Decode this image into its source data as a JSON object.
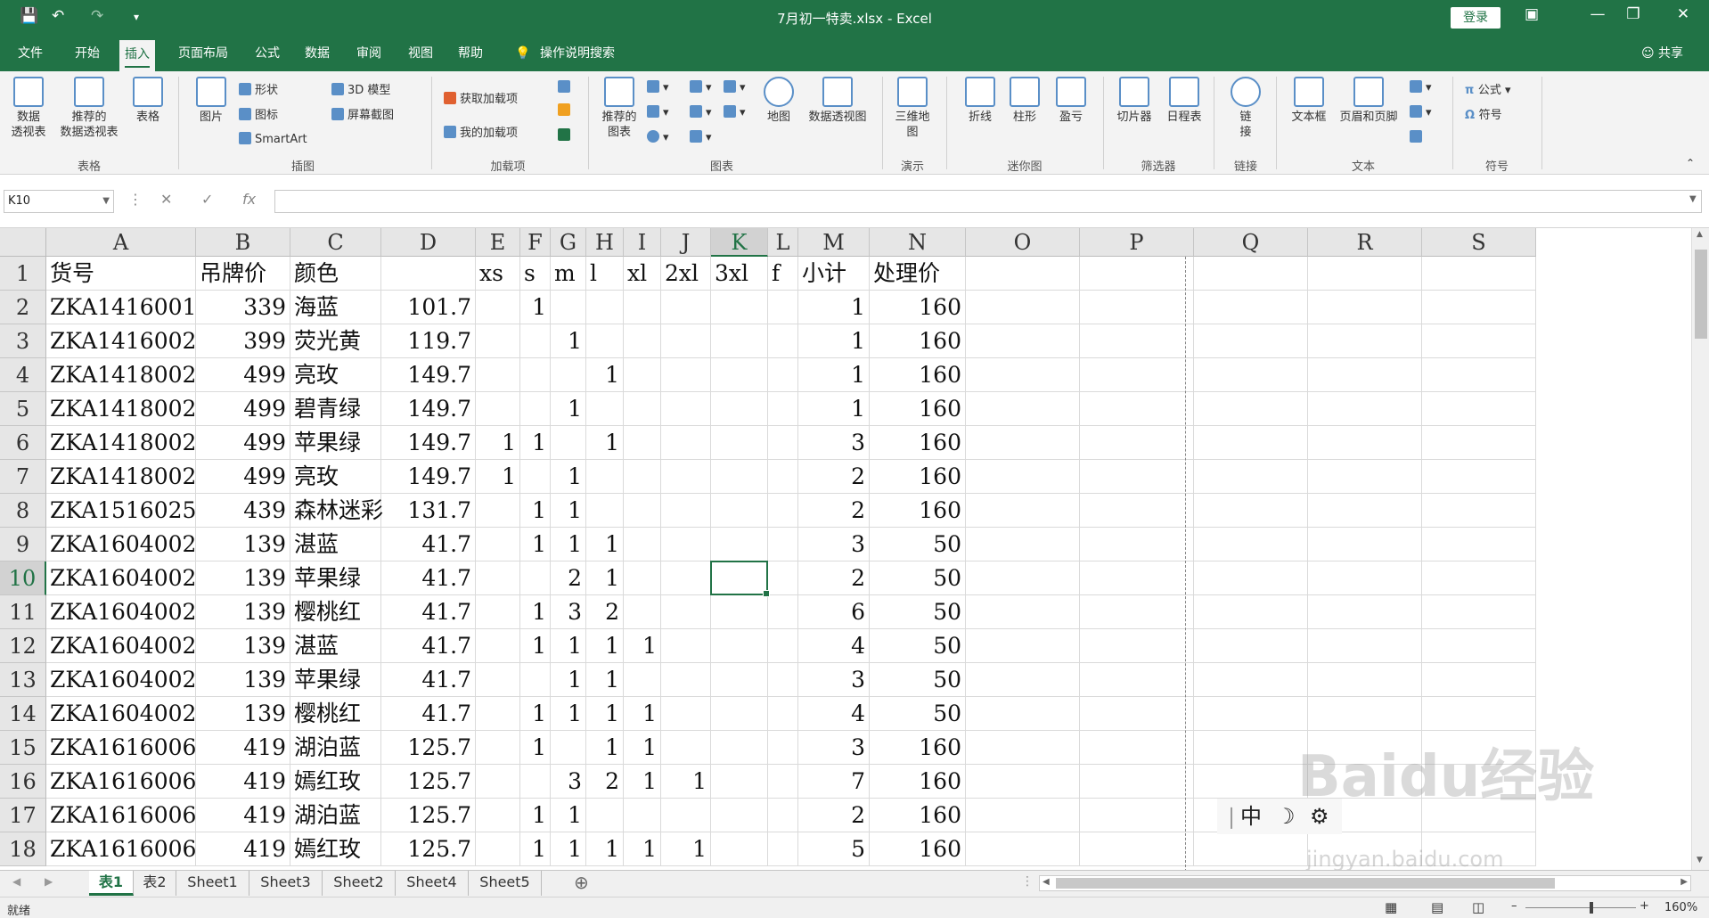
{
  "window": {
    "title": "7月初一特卖.xlsx  -  Excel",
    "login_label": "登录",
    "share_label": "共享",
    "tell_me": "操作说明搜索"
  },
  "tabs": [
    "文件",
    "开始",
    "插入",
    "页面布局",
    "公式",
    "数据",
    "审阅",
    "视图",
    "帮助"
  ],
  "active_tab": "插入",
  "ribbon": {
    "groups": [
      "表格",
      "插图",
      "加载项",
      "图表",
      "演示",
      "迷你图",
      "筛选器",
      "链接",
      "文本",
      "符号"
    ],
    "table_btns": [
      "数据\n透视表",
      "推荐的\n数据透视表",
      "表格"
    ],
    "illus_big": "图片",
    "illus_small": [
      "形状",
      "图标",
      "SmartArt",
      "3D 模型",
      "屏幕截图"
    ],
    "addins": [
      "获取加载项",
      "我的加载项"
    ],
    "charts": [
      "推荐的\n图表",
      "地图",
      "数据透视图"
    ],
    "tour": "三维地\n图",
    "spark": [
      "折线",
      "柱形",
      "盈亏"
    ],
    "filters": [
      "切片器",
      "日程表"
    ],
    "link": "链\n接",
    "text": [
      "文本框",
      "页眉和页脚"
    ],
    "symbols": [
      "公式",
      "符号"
    ]
  },
  "formula_bar": {
    "name_box": "K10",
    "fx": "fx",
    "value": ""
  },
  "columns": [
    "A",
    "B",
    "C",
    "D",
    "E",
    "F",
    "G",
    "H",
    "I",
    "J",
    "K",
    "L",
    "M",
    "N",
    "O",
    "P",
    "Q",
    "R",
    "S"
  ],
  "selected_col": "K",
  "selected_row": 10,
  "header_row": [
    "货号",
    "吊牌价",
    "颜色",
    "",
    "xs",
    "s",
    "m",
    "l",
    "xl",
    "2xl",
    "3xl",
    "f",
    "小计",
    "处理价"
  ],
  "rows": [
    [
      "ZKA1416001",
      "339",
      "海蓝",
      "101.7",
      "",
      "1",
      "",
      "",
      "",
      "",
      "",
      "",
      "1",
      "160"
    ],
    [
      "ZKA1416002",
      "399",
      "荧光黄",
      "119.7",
      "",
      "",
      "1",
      "",
      "",
      "",
      "",
      "",
      "1",
      "160"
    ],
    [
      "ZKA1418002",
      "499",
      "亮玫",
      "149.7",
      "",
      "",
      "",
      "1",
      "",
      "",
      "",
      "",
      "1",
      "160"
    ],
    [
      "ZKA1418002",
      "499",
      "碧青绿",
      "149.7",
      "",
      "",
      "1",
      "",
      "",
      "",
      "",
      "",
      "1",
      "160"
    ],
    [
      "ZKA1418002",
      "499",
      "苹果绿",
      "149.7",
      "1",
      "1",
      "",
      "1",
      "",
      "",
      "",
      "",
      "3",
      "160"
    ],
    [
      "ZKA1418002",
      "499",
      "亮玫",
      "149.7",
      "1",
      "",
      "1",
      "",
      "",
      "",
      "",
      "",
      "2",
      "160"
    ],
    [
      "ZKA1516025",
      "439",
      "森林迷彩",
      "131.7",
      "",
      "1",
      "1",
      "",
      "",
      "",
      "",
      "",
      "2",
      "160"
    ],
    [
      "ZKA1604002",
      "139",
      "湛蓝",
      "41.7",
      "",
      "1",
      "1",
      "1",
      "",
      "",
      "",
      "",
      "3",
      "50"
    ],
    [
      "ZKA1604002",
      "139",
      "苹果绿",
      "41.7",
      "",
      "",
      "2",
      "1",
      "",
      "",
      "",
      "",
      "2",
      "50"
    ],
    [
      "ZKA1604002",
      "139",
      "樱桃红",
      "41.7",
      "",
      "1",
      "3",
      "2",
      "",
      "",
      "",
      "",
      "6",
      "50"
    ],
    [
      "ZKA1604002",
      "139",
      "湛蓝",
      "41.7",
      "",
      "1",
      "1",
      "1",
      "1",
      "",
      "",
      "",
      "4",
      "50"
    ],
    [
      "ZKA1604002",
      "139",
      "苹果绿",
      "41.7",
      "",
      "",
      "1",
      "1",
      "",
      "",
      "",
      "",
      "3",
      "50"
    ],
    [
      "ZKA1604002",
      "139",
      "樱桃红",
      "41.7",
      "",
      "1",
      "1",
      "1",
      "1",
      "",
      "",
      "",
      "4",
      "50"
    ],
    [
      "ZKA1616006",
      "419",
      "湖泊蓝",
      "125.7",
      "",
      "1",
      "",
      "1",
      "1",
      "",
      "",
      "",
      "3",
      "160"
    ],
    [
      "ZKA1616006",
      "419",
      "嫣红玫",
      "125.7",
      "",
      "",
      "3",
      "2",
      "1",
      "1",
      "",
      "",
      "7",
      "160"
    ],
    [
      "ZKA1616006",
      "419",
      "湖泊蓝",
      "125.7",
      "",
      "1",
      "1",
      "",
      "",
      "",
      "",
      "",
      "2",
      "160"
    ],
    [
      "ZKA1616006",
      "419",
      "嫣红玫",
      "125.7",
      "",
      "1",
      "1",
      "1",
      "1",
      "1",
      "",
      "",
      "5",
      "160"
    ]
  ],
  "sheet_tabs": [
    "表1",
    "表2",
    "Sheet1",
    "Sheet3",
    "Sheet2",
    "Sheet4",
    "Sheet5"
  ],
  "active_sheet": "表1",
  "status": {
    "ready": "就绪",
    "zoom": "160%"
  },
  "ime": {
    "mode": "中"
  },
  "watermark": {
    "main": "Baidu经验",
    "sub": "jingyan.baidu.com"
  }
}
